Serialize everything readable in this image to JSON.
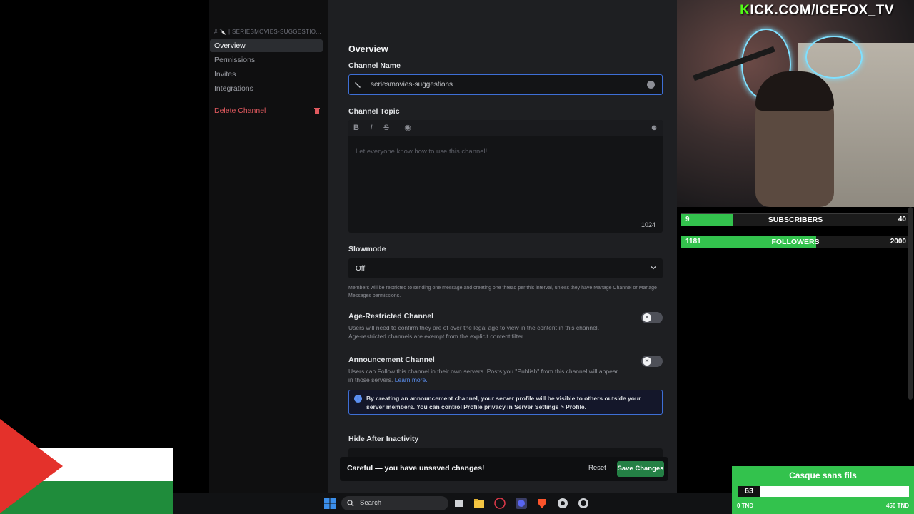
{
  "sidebar": {
    "channel_header": "# 🔪 | SERIESMOVIES-SUGGESTIO...",
    "items": [
      {
        "label": "Overview",
        "active": true
      },
      {
        "label": "Permissions",
        "active": false
      },
      {
        "label": "Invites",
        "active": false
      },
      {
        "label": "Integrations",
        "active": false
      }
    ],
    "delete_label": "Delete Channel"
  },
  "main": {
    "title": "Overview",
    "channel_name_label": "Channel Name",
    "channel_name_value": "seriesmovies-suggestions",
    "channel_topic_label": "Channel Topic",
    "topic_placeholder": "Let everyone know how to use this channel!",
    "topic_char_count": "1024",
    "slowmode_label": "Slowmode",
    "slowmode_value": "Off",
    "slowmode_help": "Members will be restricted to sending one message and creating one thread per this interval, unless they have Manage Channel or Manage Messages permissions.",
    "age_label": "Age-Restricted Channel",
    "age_desc_1": "Users will need to confirm they are of over the legal age to view in the content in this channel.",
    "age_desc_2": "Age-restricted channels are exempt from the explicit content filter.",
    "announce_label": "Announcement Channel",
    "announce_desc": "Users can Follow this channel in their own servers. Posts you \"Publish\" from this channel will appear in those servers.",
    "learn_more": "Learn more.",
    "info_text": "By creating an announcement channel, your server profile will be visible to others outside your server members. You can control Profile privacy in Server Settings > Profile.",
    "hide_label": "Hide After Inactivity",
    "unsaved_msg": "Careful — you have unsaved changes!",
    "reset_label": "Reset",
    "save_label": "Save Changes"
  },
  "stream": {
    "kick_url_k": "K",
    "kick_url_rest": "ICK.COM/ICEFOX_TV",
    "subs": {
      "current": "9",
      "label": "SUBSCRIBERS",
      "goal": "40",
      "fraction": 0.225
    },
    "followers": {
      "current": "1181",
      "label": "FOLLOWERS",
      "goal": "2000",
      "fraction": 0.59
    },
    "goal_widget": {
      "title": "Casque sans fils",
      "value": "63",
      "min": "0 TND",
      "max": "450 TND",
      "fraction": 0.14
    }
  },
  "taskbar": {
    "search_label": "Search"
  },
  "colors": {
    "accent": "#3e6fd6",
    "danger": "#e0595e",
    "save_green": "#248045",
    "kick_green": "#53fc18",
    "bar_green": "#33c24d"
  }
}
